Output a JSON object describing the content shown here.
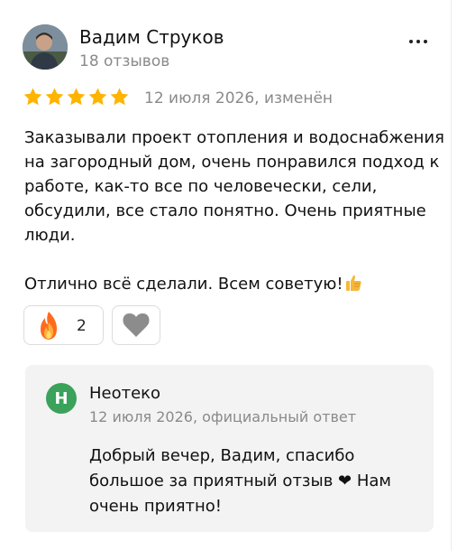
{
  "author": {
    "name": "Вадим Струков",
    "reviews_count": "18 отзывов"
  },
  "review": {
    "rating": 5,
    "date": "12 июля 2026, изменён",
    "paragraph_1": "Заказывали проект отопления и водоснабжения на загородный дом, очень понравился подход к работе, как-то все по человечески, сели, обсудили, все стало понятно. Очень приятные люди.",
    "paragraph_2": "Отлично всё сделали. Всем советую!",
    "paragraph_2_icon": "thumbs-up-icon"
  },
  "reactions": {
    "fire_icon": "fire-icon",
    "fire_count": "2",
    "heart_icon": "heart-icon"
  },
  "reply": {
    "avatar_letter": "Н",
    "avatar_color": "#3aa25a",
    "name": "Неотеко",
    "meta": "12 июля 2026, официальный ответ",
    "text": "Добрый вечер, Вадим, спасибо большое за приятный отзыв ❤ Нам очень приятно!"
  },
  "colors": {
    "star": "#ffb400",
    "muted_text": "#8a8a8a",
    "reply_bg": "#f3f3f3"
  }
}
